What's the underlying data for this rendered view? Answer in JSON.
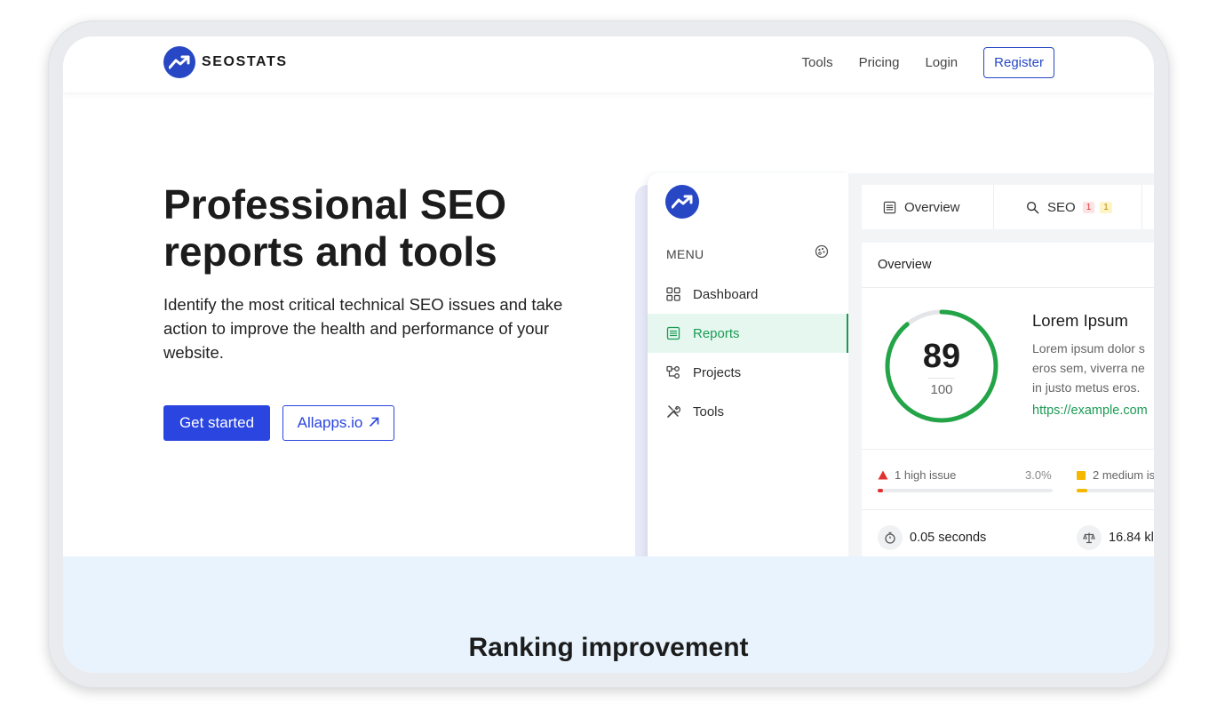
{
  "brand": {
    "name": "SEOSTATS",
    "accent": "#2747c4"
  },
  "nav": {
    "links": [
      {
        "label": "Tools"
      },
      {
        "label": "Pricing"
      },
      {
        "label": "Login"
      }
    ],
    "register_label": "Register"
  },
  "hero": {
    "title": "Professional SEO reports and tools",
    "subtitle": "Identify the most critical technical SEO issues and take action to improve the health and performance of your website.",
    "primary_cta": "Get started",
    "secondary_cta": "Allapps.io",
    "secondary_cta_icon": "external-link-arrow-icon"
  },
  "app_preview": {
    "menu_label": "MENU",
    "menu_items": [
      {
        "label": "Dashboard",
        "icon": "grid-icon",
        "active": false
      },
      {
        "label": "Reports",
        "icon": "report-list-icon",
        "active": true
      },
      {
        "label": "Projects",
        "icon": "projects-icon",
        "active": false
      },
      {
        "label": "Tools",
        "icon": "tools-icon",
        "active": false
      }
    ],
    "tabs": [
      {
        "label": "Overview",
        "icon": "overview-icon"
      },
      {
        "label": "SEO",
        "icon": "search-icon",
        "badge_red": "1",
        "badge_yellow": "1"
      }
    ],
    "card": {
      "title": "Overview",
      "score": "89",
      "score_max": "100",
      "score_fraction": 0.89,
      "info_title": "Lorem Ipsum",
      "info_lines": [
        "Lorem ipsum dolor s",
        "eros sem, viverra ne",
        "in justo metus eros."
      ],
      "info_link": "https://example.com",
      "issues": [
        {
          "label": "1 high issue",
          "percent": "3.0%",
          "fraction": 0.03,
          "color": "#e03131"
        },
        {
          "label": "2 medium is",
          "fraction": 0.12,
          "color": "#f5b800"
        }
      ],
      "stats": [
        {
          "value": "0.05 seconds",
          "icon": "stopwatch-icon"
        },
        {
          "value": "16.84 kl",
          "icon": "scale-icon"
        }
      ]
    },
    "success_color": "#1c9a55"
  },
  "section": {
    "title": "Ranking improvement"
  }
}
